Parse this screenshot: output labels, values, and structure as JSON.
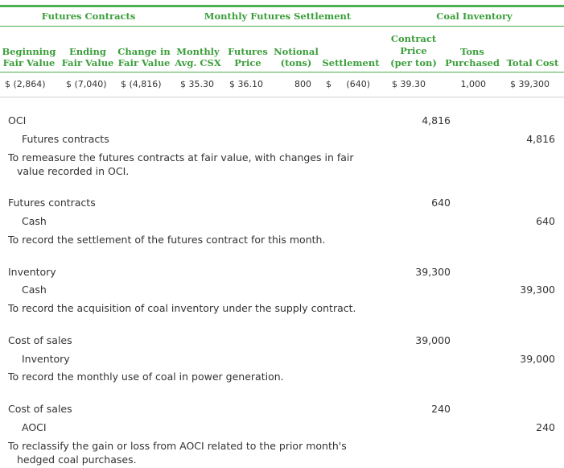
{
  "table": {
    "group_headers": {
      "futures_contracts": "Futures Contracts",
      "monthly_settlement": "Monthly Futures Settlement",
      "coal_inventory": "Coal Inventory"
    },
    "columns": {
      "beginning_fv": [
        "Beginning",
        "Fair Value"
      ],
      "ending_fv": [
        "Ending",
        "Fair Value"
      ],
      "change_fv": [
        "Change in",
        "Fair Value"
      ],
      "monthly_avg": [
        "Monthly",
        "Avg. CSX"
      ],
      "futures_price": [
        "Futures",
        "Price"
      ],
      "notional": [
        "Notional",
        "(tons)"
      ],
      "settlement": "Settlement",
      "contract_price": [
        "Contract",
        "Price",
        "(per ton)"
      ],
      "tons_purchased": [
        "Tons",
        "Purchased"
      ],
      "total_cost": "Total Cost"
    },
    "row": {
      "beginning_fv": "$ (2,864)",
      "ending_fv": "$  (7,040)",
      "change_fv": "$  (4,816)",
      "monthly_avg": "$ 35.30",
      "futures_price": "$ 36.10",
      "notional": "800",
      "settlement_cur": "$",
      "settlement_val": "(640)",
      "contract_price": "$  39.30",
      "tons_purchased": "1,000",
      "total_cost": "$  39,300"
    }
  },
  "entries": [
    {
      "debit_account": "OCI",
      "debit_amount": "4,816",
      "credit_account": "Futures contracts",
      "credit_amount": "4,816",
      "description_lines": [
        "To remeasure the futures contracts at fair value, with changes in fair",
        "value recorded in OCI."
      ]
    },
    {
      "debit_account": "Futures contracts",
      "debit_amount": "640",
      "credit_account": "Cash",
      "credit_amount": "640",
      "description_lines": [
        "To record the settlement of the futures contract for this month."
      ]
    },
    {
      "debit_account": "Inventory",
      "debit_amount": "39,300",
      "credit_account": "Cash",
      "credit_amount": "39,300",
      "description_lines": [
        "To record the acquisition of coal inventory under the supply contract."
      ]
    },
    {
      "debit_account": "Cost of sales",
      "debit_amount": "39,000",
      "credit_account": "Inventory",
      "credit_amount": "39,000",
      "description_lines": [
        "To record the monthly use of coal in power generation."
      ]
    },
    {
      "debit_account": "Cost of sales",
      "debit_amount": "240",
      "credit_account": "AOCI",
      "credit_amount": "240",
      "description_lines": [
        "To reclassify the gain or loss from AOCI related to the prior month's",
        "hedged coal purchases."
      ]
    }
  ],
  "colors": {
    "accent": "#3a9e3a",
    "rule": "#4caf50",
    "light_rule": "#cfcfcf"
  }
}
